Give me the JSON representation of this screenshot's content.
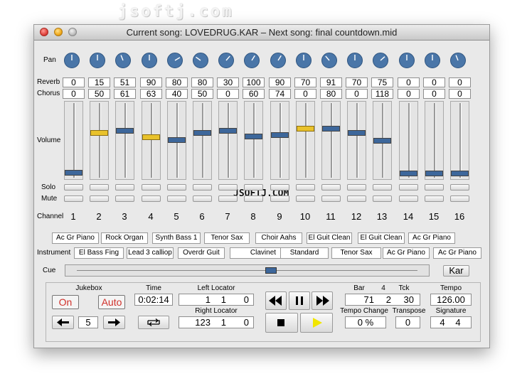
{
  "watermark_top": "jsoftj.com",
  "watermark_mid": "JSOFTJ.COM",
  "window_title": "Current song: LOVEDRUG.KAR – Next song: final countdown.mid",
  "labels": {
    "pan": "Pan",
    "reverb": "Reverb",
    "chorus": "Chorus",
    "volume": "Volume",
    "solo": "Solo",
    "mute": "Mute",
    "channel": "Channel",
    "instrument": "Instrument",
    "cue": "Cue"
  },
  "channels": [
    {
      "num": "1",
      "reverb": "0",
      "chorus": "0",
      "volume": 0.03,
      "thumb": "blue",
      "pan": 0.5
    },
    {
      "num": "2",
      "reverb": "15",
      "chorus": "50",
      "volume": 0.6,
      "thumb": "yellow",
      "pan": 0.5
    },
    {
      "num": "3",
      "reverb": "51",
      "chorus": "61",
      "volume": 0.63,
      "thumb": "blue",
      "pan": 0.42
    },
    {
      "num": "4",
      "reverb": "90",
      "chorus": "63",
      "volume": 0.54,
      "thumb": "yellow",
      "pan": 0.5
    },
    {
      "num": "5",
      "reverb": "80",
      "chorus": "40",
      "volume": 0.5,
      "thumb": "blue",
      "pan": 0.72
    },
    {
      "num": "6",
      "reverb": "80",
      "chorus": "50",
      "volume": 0.6,
      "thumb": "blue",
      "pan": 0.3
    },
    {
      "num": "7",
      "reverb": "30",
      "chorus": "0",
      "volume": 0.63,
      "thumb": "blue",
      "pan": 0.65
    },
    {
      "num": "8",
      "reverb": "100",
      "chorus": "60",
      "volume": 0.55,
      "thumb": "blue",
      "pan": 0.62
    },
    {
      "num": "9",
      "reverb": "90",
      "chorus": "74",
      "volume": 0.57,
      "thumb": "blue",
      "pan": 0.62
    },
    {
      "num": "10",
      "reverb": "70",
      "chorus": "0",
      "volume": 0.66,
      "thumb": "yellow",
      "pan": 0.5
    },
    {
      "num": "11",
      "reverb": "91",
      "chorus": "80",
      "volume": 0.66,
      "thumb": "blue",
      "pan": 0.35
    },
    {
      "num": "12",
      "reverb": "70",
      "chorus": "0",
      "volume": 0.6,
      "thumb": "blue",
      "pan": 0.5
    },
    {
      "num": "13",
      "reverb": "75",
      "chorus": "118",
      "volume": 0.48,
      "thumb": "blue",
      "pan": 0.68
    },
    {
      "num": "14",
      "reverb": "0",
      "chorus": "0",
      "volume": 0.02,
      "thumb": "blue",
      "pan": 0.5
    },
    {
      "num": "15",
      "reverb": "0",
      "chorus": "0",
      "volume": 0.02,
      "thumb": "blue",
      "pan": 0.5
    },
    {
      "num": "16",
      "reverb": "0",
      "chorus": "0",
      "volume": 0.02,
      "thumb": "blue",
      "pan": 0.42
    }
  ],
  "instruments_row1": [
    "Ac Gr Piano",
    "Rock Organ",
    "Synth Bass 1",
    "Tenor Sax",
    "Choir Aahs",
    "El Guit Clean",
    "El Guit Clean",
    "Ac Gr Piano"
  ],
  "instruments_row2": [
    "El Bass Fing",
    "Lead 3 calliop",
    "Overdr Guit",
    "Clavinet",
    "Standard",
    "Tenor Sax",
    "Ac Gr Piano",
    "Ac Gr Piano"
  ],
  "cue_position": 0.57,
  "kar_label": "Kar",
  "jukebox": {
    "title": "Jukebox",
    "on_label": "On",
    "auto_label": "Auto",
    "count": "5",
    "prev_icon": "arrow-left-icon",
    "next_icon": "arrow-right-icon"
  },
  "time": {
    "title": "Time",
    "value": "0:02:14",
    "loop_icon": "loop-icon"
  },
  "left_locator": {
    "title": "Left Locator",
    "bar": "1",
    "beat": "1",
    "tick": "0"
  },
  "right_locator": {
    "title": "Right Locator",
    "bar": "123",
    "beat": "1",
    "tick": "0"
  },
  "transport": {
    "rewind_icon": "rewind-icon",
    "pause_icon": "pause-icon",
    "forward_icon": "fast-forward-icon",
    "stop_icon": "stop-icon",
    "play_icon": "play-icon",
    "play_color": "#f2e600"
  },
  "position": {
    "bar_label": "Bar",
    "beat_header": "4",
    "tick_label": "Tck",
    "bar": "71",
    "beat": "2",
    "tick": "30"
  },
  "tempo": {
    "title": "Tempo",
    "value": "126.00"
  },
  "tempo_change": {
    "title": "Tempo Change",
    "value": "0 %"
  },
  "transpose": {
    "title": "Transpose",
    "value": "0"
  },
  "signature": {
    "title": "Signature",
    "num": "4",
    "den": "4"
  },
  "colors": {
    "knob": "#4a76a8",
    "thumb_blue": "#3d679b",
    "thumb_yellow": "#e9c22b",
    "accent_red": "#d0302a"
  }
}
